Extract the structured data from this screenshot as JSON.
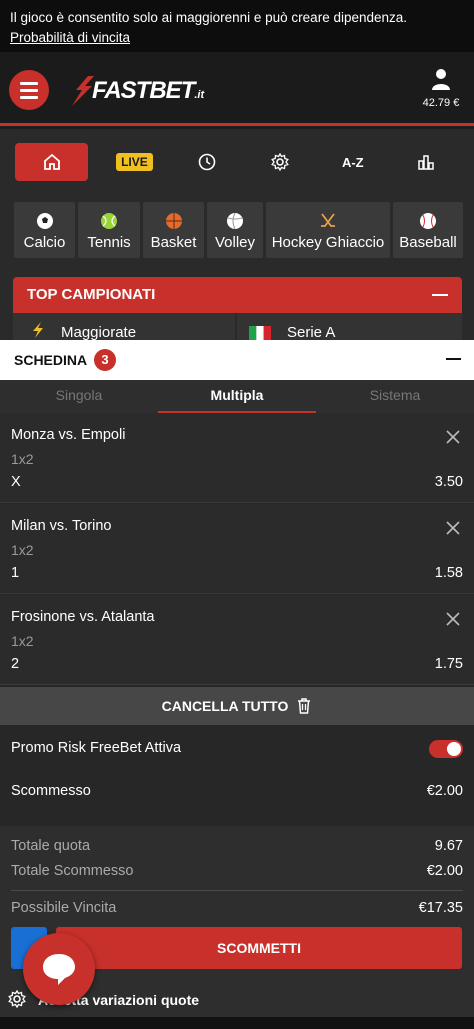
{
  "notice": {
    "text": "Il gioco è consentito solo ai maggiorenni e può creare dipendenza.",
    "link": "Probabilità di vincita"
  },
  "header": {
    "logo": "FASTBET",
    "logo_suffix": ".it",
    "balance": "42.79 €",
    "icons": [
      "menu-icon",
      "user-icon"
    ]
  },
  "nav": {
    "items": [
      {
        "name": "home",
        "icon": "home-icon"
      },
      {
        "name": "live",
        "label": "LIVE"
      },
      {
        "name": "history",
        "icon": "clock-icon"
      },
      {
        "name": "settings",
        "icon": "gear-icon"
      },
      {
        "name": "az",
        "label": "A-Z"
      },
      {
        "name": "stats",
        "icon": "chart-icon"
      }
    ]
  },
  "sports": [
    {
      "label": "Calcio",
      "icon": "soccer-ball-icon"
    },
    {
      "label": "Tennis",
      "icon": "tennis-ball-icon"
    },
    {
      "label": "Basket",
      "icon": "basketball-icon"
    },
    {
      "label": "Volley",
      "icon": "volleyball-icon"
    },
    {
      "label": "Hockey Ghiaccio",
      "icon": "hockey-icon"
    },
    {
      "label": "Baseball",
      "icon": "baseball-icon"
    }
  ],
  "top_campionati": {
    "title": "TOP CAMPIONATI",
    "items": [
      {
        "label": "Maggiorate",
        "icon": "boost-icon"
      },
      {
        "label": "Serie A",
        "icon": "italy-flag-icon"
      }
    ]
  },
  "betslip": {
    "title": "SCHEDINA",
    "count": "3",
    "tabs": [
      {
        "label": "Singola",
        "active": false
      },
      {
        "label": "Multipla",
        "active": true
      },
      {
        "label": "Sistema",
        "active": false
      }
    ],
    "bets": [
      {
        "match": "Monza vs. Empoli",
        "market": "1x2",
        "selection": "X",
        "odd": "3.50"
      },
      {
        "match": "Milan vs. Torino",
        "market": "1x2",
        "selection": "1",
        "odd": "1.58"
      },
      {
        "match": "Frosinone vs. Atalanta",
        "market": "1x2",
        "selection": "2",
        "odd": "1.75"
      }
    ],
    "cancel_all": "CANCELLA TUTTO",
    "promo_label": "Promo Risk FreeBet Attiva",
    "promo_enabled": true,
    "stake_label": "Scommesso",
    "stake_value": "€2.00",
    "summary": {
      "total_odds_label": "Totale quota",
      "total_odds_value": "9.67",
      "total_stake_label": "Totale Scommesso",
      "total_stake_value": "€2.00",
      "potential_win_label": "Possibile Vincita",
      "potential_win_value": "€17.35"
    },
    "bet_button": "SCOMMETTI",
    "accept_changes": "Accetta variazioni quote"
  },
  "colors": {
    "accent": "#c8302b",
    "live": "#f0c020",
    "background": "#272727"
  }
}
